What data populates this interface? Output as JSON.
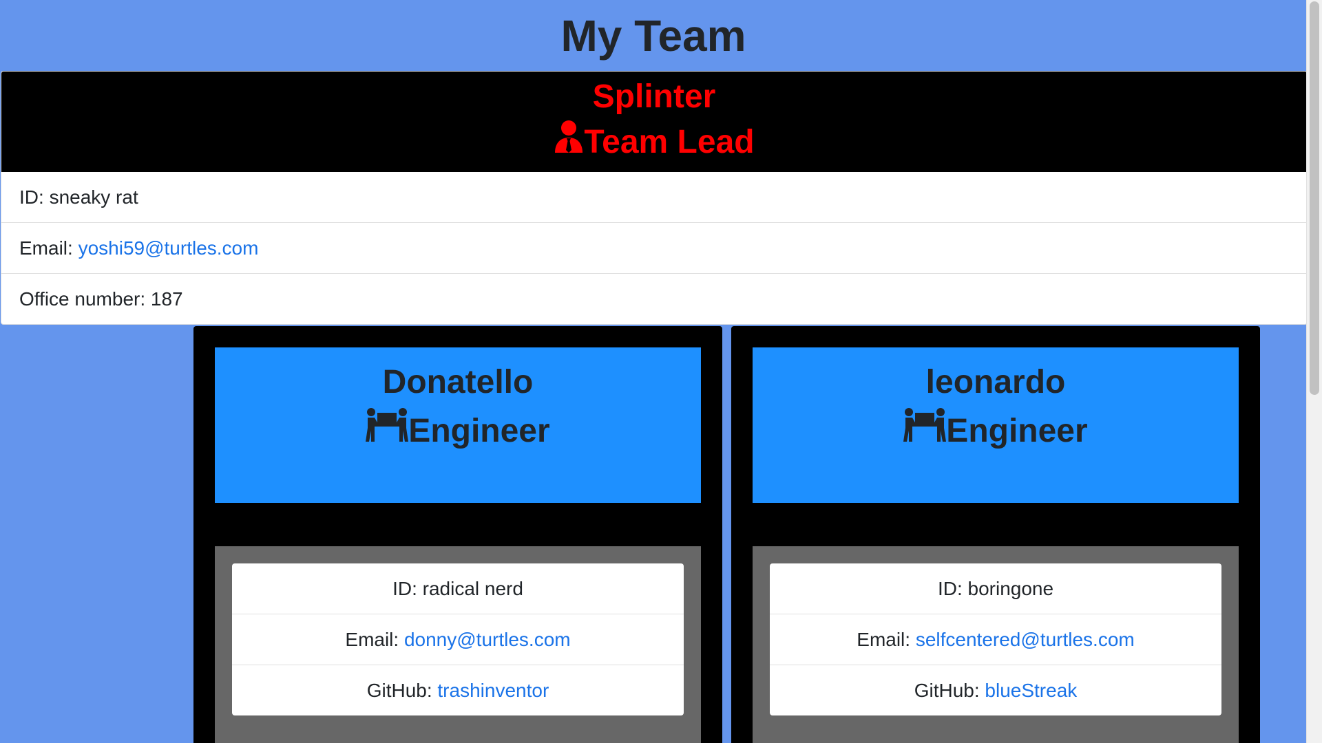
{
  "header": {
    "title": "My Team"
  },
  "manager": {
    "name": "Splinter",
    "role": "Team Lead",
    "role_icon": "user-tie-icon",
    "color": "#ff0000",
    "id_label": "ID: ",
    "id": "sneaky rat",
    "email_label": "Email: ",
    "email": "yoshi59@turtles.com",
    "office_label": "Office number: ",
    "office": "187"
  },
  "engineers": [
    {
      "name": "Donatello",
      "role": "Engineer",
      "role_icon": "people-carry-icon",
      "id_label": "ID: ",
      "id": "radical nerd",
      "email_label": "Email: ",
      "email": "donny@turtles.com",
      "github_label": "GitHub: ",
      "github": "trashinventor"
    },
    {
      "name": "leonardo",
      "role": "Engineer",
      "role_icon": "people-carry-icon",
      "id_label": "ID: ",
      "id": "boringone",
      "email_label": "Email: ",
      "email": "selfcentered@turtles.com",
      "github_label": "GitHub: ",
      "github": "blueStreak"
    }
  ],
  "colors": {
    "page_bg": "#6495ed",
    "card_header_bg": "#1e90ff",
    "link": "#1a73e8"
  }
}
